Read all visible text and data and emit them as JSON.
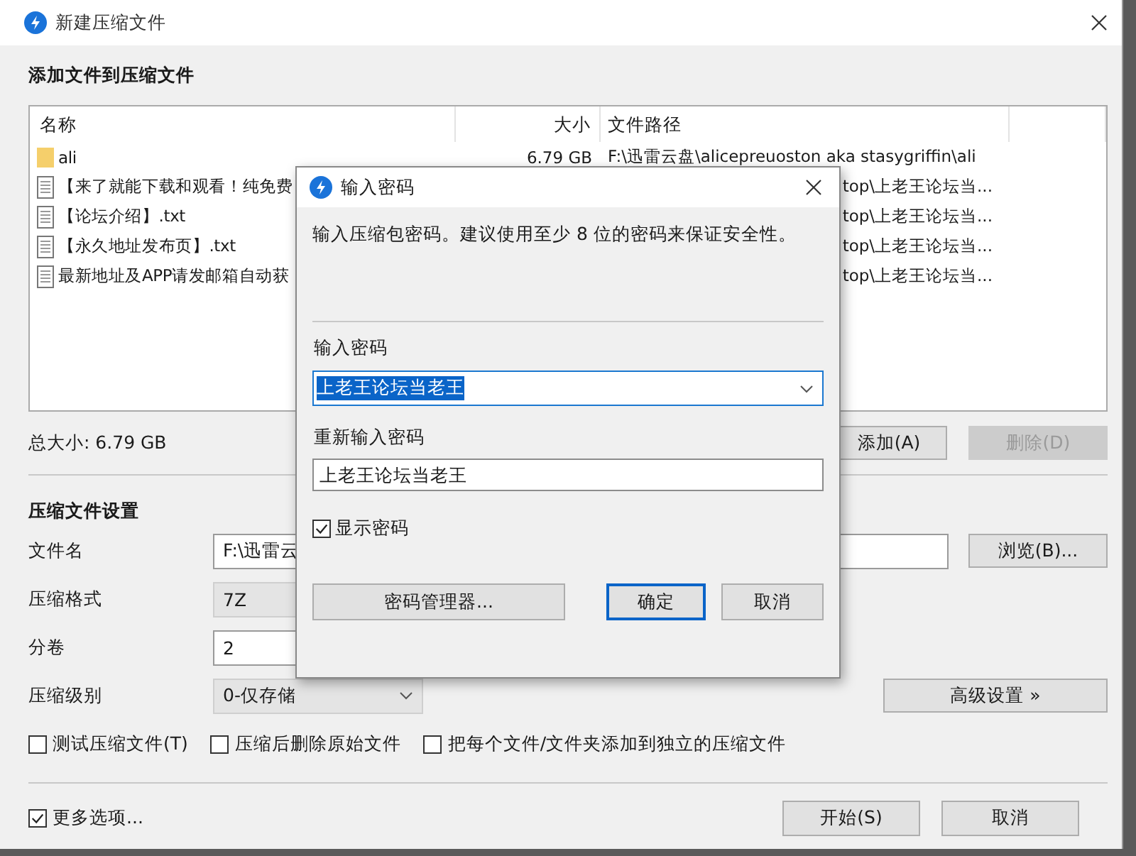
{
  "window": {
    "title": "新建压缩文件"
  },
  "files_section": {
    "heading": "添加文件到压缩文件",
    "columns": [
      "名称",
      "大小",
      "文件路径"
    ],
    "rows": [
      {
        "kind": "folder",
        "name": "ali",
        "size": "6.79 GB",
        "path": "F:\\迅雷云盘\\alicepreuoston aka stasygriffin\\ali"
      },
      {
        "kind": "file",
        "name": "【来了就能下载和观看！纯免费",
        "path": "top\\上老王论坛当..."
      },
      {
        "kind": "file",
        "name": "【论坛介绍】.txt",
        "path": "top\\上老王论坛当..."
      },
      {
        "kind": "file",
        "name": "【永久地址发布页】.txt",
        "path": "top\\上老王论坛当..."
      },
      {
        "kind": "file",
        "name": "最新地址及APP请发邮箱自动获",
        "path": "top\\上老王论坛当..."
      }
    ],
    "total": "总大小: 6.79 GB",
    "buttons": [
      {
        "label": "添加(A)",
        "disabled": false
      },
      {
        "label": "删除(D)",
        "disabled": true
      }
    ]
  },
  "settings": {
    "heading": "压缩文件设置",
    "fields": [
      {
        "label": "文件名",
        "kind": "text",
        "value": "F:\\迅雷云"
      },
      {
        "label": "压缩格式",
        "kind": "readonly",
        "value": "7Z"
      },
      {
        "label": "分卷",
        "kind": "text",
        "value": "2"
      },
      {
        "label": "压缩级别",
        "kind": "select",
        "value": "0-仅存储"
      }
    ],
    "browse_button": "浏览(B)...",
    "advanced_button": "高级设置 »",
    "options": [
      {
        "label": "测试压缩文件(T)",
        "checked": false
      },
      {
        "label": "压缩后删除原始文件",
        "checked": false
      },
      {
        "label": "把每个文件/文件夹添加到独立的压缩文件",
        "checked": false
      }
    ]
  },
  "footer": {
    "more_options": {
      "label": "更多选项...",
      "checked": true
    },
    "buttons": [
      "开始(S)",
      "取消"
    ]
  },
  "dialog": {
    "title": "输入密码",
    "description": "输入压缩包密码。建议使用至少 8 位的密码来保证安全性。",
    "password_label": "输入密码",
    "password": "上老王论坛当老王",
    "password_selected": true,
    "confirm_label": "重新输入密码",
    "confirm_value": "上老王论坛当老王",
    "show_password": {
      "label": "显示密码",
      "checked": true
    },
    "buttons": [
      {
        "label": "密码管理器...",
        "kind": "manager"
      },
      {
        "label": "确定",
        "kind": "default"
      },
      {
        "label": "取消",
        "kind": "cancel"
      }
    ]
  }
}
